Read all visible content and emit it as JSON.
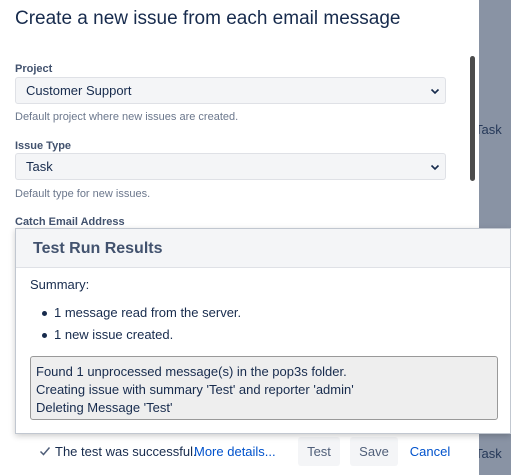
{
  "dialog": {
    "title": "Create a new issue from each email message",
    "fields": {
      "project": {
        "label": "Project",
        "value": "Customer Support",
        "help": "Default project where new issues are created."
      },
      "issue_type": {
        "label": "Issue Type",
        "value": "Task",
        "help": "Default type for new issues."
      },
      "catch_email": {
        "label": "Catch Email Address"
      }
    }
  },
  "background": {
    "task_label_1": "Task",
    "task_label_2": "Task"
  },
  "results": {
    "title": "Test Run Results",
    "summary_label": "Summary:",
    "items": [
      "1 message read from the server.",
      "1 new issue created."
    ],
    "log": [
      "Found 1 unprocessed message(s) in the pop3s folder.",
      "Creating issue with summary 'Test' and reporter 'admin'",
      "Deleting Message 'Test'"
    ]
  },
  "footer": {
    "status": "The test was successful.",
    "more_details": "More details...",
    "test_label": "Test",
    "save_label": "Save",
    "cancel_label": "Cancel"
  },
  "icons": {
    "dropdown": "chevron-down-icon",
    "success": "check-icon"
  }
}
